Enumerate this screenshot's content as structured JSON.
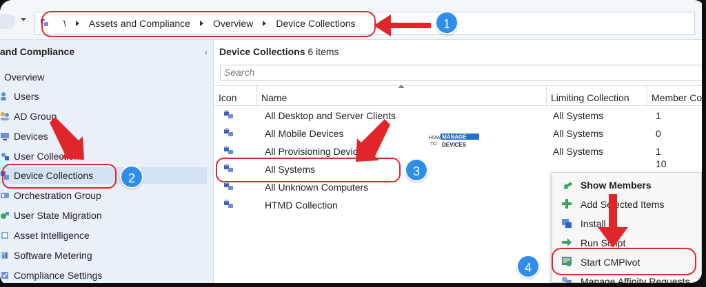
{
  "address_bar": {
    "root": "\\",
    "crumbs": [
      "Assets and Compliance",
      "Overview",
      "Device Collections"
    ]
  },
  "left_pane": {
    "heading": "and Compliance",
    "collapse_icon": "‹",
    "items": [
      {
        "label": "Overview",
        "icon": "overview-icon"
      },
      {
        "label": "Users",
        "icon": "users-icon"
      },
      {
        "label": "AD Group",
        "icon": "ad-group-icon"
      },
      {
        "label": "Devices",
        "icon": "devices-icon"
      },
      {
        "label": "User Collections",
        "icon": "user-collections-icon"
      },
      {
        "label": "Device Collections",
        "icon": "device-collections-icon"
      },
      {
        "label": "Orchestration Group",
        "icon": "orchestration-group-icon"
      },
      {
        "label": "User State Migration",
        "icon": "user-state-migration-icon"
      },
      {
        "label": "Asset Intelligence",
        "icon": "asset-intelligence-icon"
      },
      {
        "label": "Software Metering",
        "icon": "software-metering-icon"
      },
      {
        "label": "Compliance Settings",
        "icon": "compliance-settings-icon"
      }
    ]
  },
  "right_pane": {
    "title": "Device Collections",
    "count": "6 items",
    "search_placeholder": "Search",
    "columns": [
      "Icon",
      "Name",
      "Limiting Collection",
      "Member Co"
    ],
    "rows": [
      {
        "name": "All Desktop and Server Clients",
        "limiting": "All Systems",
        "members": "1"
      },
      {
        "name": "All Mobile Devices",
        "limiting": "All Systems",
        "members": "0"
      },
      {
        "name": "All Provisioning Devices",
        "limiting": "All Systems",
        "members": "1"
      },
      {
        "name": "All Systems",
        "limiting": "",
        "members": "10"
      },
      {
        "name": "All Unknown Computers",
        "limiting": "",
        "members": ""
      },
      {
        "name": "HTMD Collection",
        "limiting": "",
        "members": ""
      }
    ]
  },
  "context_menu": {
    "items": [
      {
        "label": "Show Members",
        "icon": "show-members-icon",
        "bold": true
      },
      {
        "label": "Add Selected Items",
        "icon": "add-items-icon",
        "bold": false
      },
      {
        "label": "Install",
        "icon": "install-icon",
        "bold": false
      },
      {
        "label": "Run Script",
        "icon": "run-script-icon",
        "bold": false
      },
      {
        "label": "Start CMPivot",
        "icon": "cmpivot-icon",
        "bold": false
      },
      {
        "label": "Manage Affinity Requests",
        "icon": "affinity-icon",
        "bold": false
      }
    ]
  },
  "logo": {
    "line1": "HOW",
    "line2": "TO",
    "word1": "MANAGE",
    "word2": "DEVICES"
  },
  "badges": [
    "1",
    "2",
    "3",
    "4"
  ],
  "colors": {
    "annotation_red": "#e0262a",
    "badge_blue": "#2f8ee8",
    "selection": "#d4e2f4"
  }
}
